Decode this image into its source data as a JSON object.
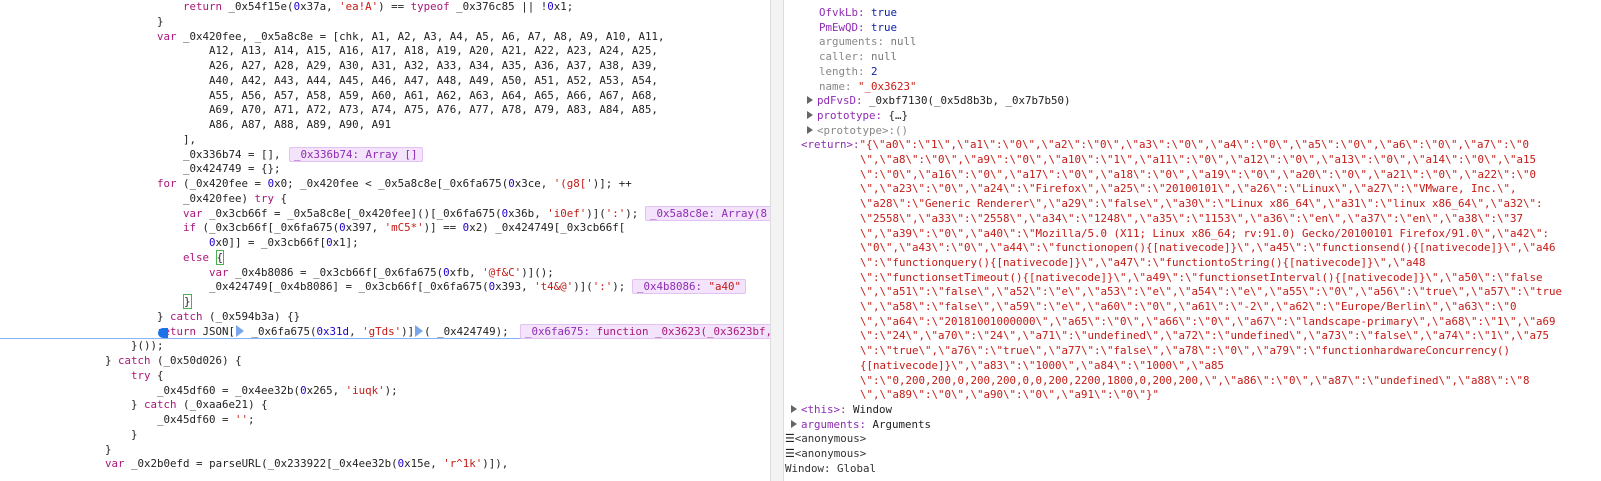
{
  "code_lines": [
    {
      "text": "        return _0x54f15e(0x37a, 'ea!A') == typeof _0x376c85 || !0x1;",
      "indent": 0
    },
    {
      "text": "    }"
    },
    {
      "text": "    var _0x420fee, _0x5a8c8e = [chk, A1, A2, A3, A4, A5, A6, A7, A8, A9, A10, A11,"
    },
    {
      "text": "        A12, A13, A14, A15, A16, A17, A18, A19, A20, A21, A22, A23, A24, A25,"
    },
    {
      "text": "        A26, A27, A28, A29, A30, A31, A32, A33, A34, A35, A36, A37, A38, A39,"
    },
    {
      "text": "        A40, A42, A43, A44, A45, A46, A47, A48, A49, A50, A51, A52, A53, A54,"
    },
    {
      "text": "        A55, A56, A57, A58, A59, A60, A61, A62, A63, A64, A65, A66, A67, A68,"
    },
    {
      "text": "        A69, A70, A71, A72, A73, A74, A75, A76, A77, A78, A79, A83, A84, A85,"
    },
    {
      "text": "        A86, A87, A88, A89, A90, A91"
    },
    {
      "text": "    ],"
    },
    {
      "text": "    _0x336b74 = [],"
    },
    {
      "text": "    _0x424749 = {};"
    },
    {
      "text": "    for (_0x420fee = 0x0; _0x420fee < _0x5a8c8e[_0x6fa675(0x3ce, '(g8[')]; ++"
    },
    {
      "text": "    _0x420fee) try {"
    },
    {
      "text": "        var _0x3cb66f = _0x5a8c8e[_0x420fee]()[_0x6fa675(0x36b, 'i0ef')](':');"
    },
    {
      "text": "        if (_0x3cb66f[_0x6fa675(0x397, 'mC5*')] == 0x2) _0x424749[_0x3cb66f["
    },
    {
      "text": "            0x0]] = _0x3cb66f[0x1];"
    },
    {
      "text": "        else {"
    },
    {
      "text": "            var _0x4b8086 = _0x3cb66f[_0x6fa675(0xfb, '@f&C')]();"
    },
    {
      "text": "            _0x424749[_0x4b8086] = _0x3cb66f[_0x6fa675(0x393, 't4&@')](':');"
    },
    {
      "text": "        }"
    },
    {
      "text": "    } catch (_0x594b3a) {}"
    },
    {
      "text": "    return JSON[ _0x6fa675(0x31d, 'gTds')]( _0x424749);"
    },
    {
      "text": "}());"
    },
    {
      "text": "} catch (_0x50d026) {"
    },
    {
      "text": "    try {"
    },
    {
      "text": "        _0x45df60 = _0x4ee32b(0x265, 'iuqk');"
    },
    {
      "text": "    } catch (_0xaa6e21) {"
    },
    {
      "text": "        _0x45df60 = '';"
    },
    {
      "text": "    }"
    },
    {
      "text": "}"
    },
    {
      "text": "var _0x2b0efd = parseURL(_0x233922[_0x4ee32b(0x15e, 'r^1k')]),"
    }
  ],
  "inline_values": {
    "v336b74": "_0x336b74: Array []",
    "v5a8c8e": "_0x5a8c8e: Array(8",
    "v4b8086_key": "_0x4b8086:",
    "v4b8086_val": "\"a40\"",
    "v6fa675_key": "_0x6fa675:",
    "v6fa675_val": "function _0x3623(_0x3623bf,"
  },
  "scope": {
    "props": [
      {
        "key": "OfvkLb:",
        "value": "true",
        "kind": "bool"
      },
      {
        "key": "PmEwQD:",
        "value": "true",
        "kind": "bool"
      },
      {
        "key": "arguments:",
        "value": "null",
        "kind": "null"
      },
      {
        "key": "caller:",
        "value": "null",
        "kind": "null"
      },
      {
        "key": "length:",
        "value": "2",
        "kind": "num"
      },
      {
        "key": "name:",
        "value": "\"_0x3623\"",
        "kind": "str"
      }
    ],
    "expandables": [
      {
        "key": "pdFvsD:",
        "value": "_0xbf7130(_0x5d8b3b, _0x7b7b50)"
      },
      {
        "key": "prototype:",
        "value": "{…}"
      },
      {
        "key": "<prototype>:",
        "value": "()"
      }
    ],
    "return_label": "<return>:",
    "return_lines": [
      "\"{\\\"a0\\\":\\\"1\\\",\\\"a1\\\":\\\"0\\\",\\\"a2\\\":\\\"0\\\",\\\"a3\\\":\\\"0\\\",\\\"a4\\\":\\\"0\\\",\\\"a5\\\":\\\"0\\\",\\\"a6\\\":\\\"0\\\",\\\"a7\\\":\\\"0",
      "\\\",\\\"a8\\\":\\\"0\\\",\\\"a9\\\":\\\"0\\\",\\\"a10\\\":\\\"1\\\",\\\"a11\\\":\\\"0\\\",\\\"a12\\\":\\\"0\\\",\\\"a13\\\":\\\"0\\\",\\\"a14\\\":\\\"0\\\",\\\"a15",
      "\\\":\\\"0\\\",\\\"a16\\\":\\\"0\\\",\\\"a17\\\":\\\"0\\\",\\\"a18\\\":\\\"0\\\",\\\"a19\\\":\\\"0\\\",\\\"a20\\\":\\\"0\\\",\\\"a21\\\":\\\"0\\\",\\\"a22\\\":\\\"0",
      "\\\",\\\"a23\\\":\\\"0\\\",\\\"a24\\\":\\\"Firefox\\\",\\\"a25\\\":\\\"20100101\\\",\\\"a26\\\":\\\"Linux\\\",\\\"a27\\\":\\\"VMware, Inc.\\\",",
      "\\\"a28\\\":\\\"Generic Renderer\\\",\\\"a29\\\":\\\"false\\\",\\\"a30\\\":\\\"Linux x86_64\\\",\\\"a31\\\":\\\"linux x86_64\\\",\\\"a32\\\":",
      "\\\"2558\\\",\\\"a33\\\":\\\"2558\\\",\\\"a34\\\":\\\"1248\\\",\\\"a35\\\":\\\"1153\\\",\\\"a36\\\":\\\"en\\\",\\\"a37\\\":\\\"en\\\",\\\"a38\\\":\\\"37",
      "\\\",\\\"a39\\\":\\\"0\\\",\\\"a40\\\":\\\"Mozilla/5.0 (X11; Linux x86_64; rv:91.0) Gecko/20100101 Firefox/91.0\\\",\\\"a42\\\":",
      "\\\"0\\\",\\\"a43\\\":\\\"0\\\",\\\"a44\\\":\\\"functionopen(){[nativecode]}\\\",\\\"a45\\\":\\\"functionsend(){[nativecode]}\\\",\\\"a46",
      "\\\":\\\"functionquery(){[nativecode]}\\\",\\\"a47\\\":\\\"functiontoString(){[nativecode]}\\\",\\\"a48",
      "\\\":\\\"functionsetTimeout(){[nativecode]}\\\",\\\"a49\\\":\\\"functionsetInterval(){[nativecode]}\\\",\\\"a50\\\":\\\"false",
      "\\\",\\\"a51\\\":\\\"false\\\",\\\"a52\\\":\\\"e\\\",\\\"a53\\\":\\\"e\\\",\\\"a54\\\":\\\"e\\\",\\\"a55\\\":\\\"0\\\",\\\"a56\\\":\\\"true\\\",\\\"a57\\\":\\\"true",
      "\\\",\\\"a58\\\":\\\"false\\\",\\\"a59\\\":\\\"e\\\",\\\"a60\\\":\\\"0\\\",\\\"a61\\\":\\\"-2\\\",\\\"a62\\\":\\\"Europe/Berlin\\\",\\\"a63\\\":\\\"0",
      "\\\",\\\"a64\\\":\\\"20181001000000\\\",\\\"a65\\\":\\\"0\\\",\\\"a66\\\":\\\"0\\\",\\\"a67\\\":\\\"landscape-primary\\\",\\\"a68\\\":\\\"1\\\",\\\"a69",
      "\\\":\\\"24\\\",\\\"a70\\\":\\\"24\\\",\\\"a71\\\":\\\"undefined\\\",\\\"a72\\\":\\\"undefined\\\",\\\"a73\\\":\\\"false\\\",\\\"a74\\\":\\\"1\\\",\\\"a75",
      "\\\":\\\"true\\\",\\\"a76\\\":\\\"true\\\",\\\"a77\\\":\\\"false\\\",\\\"a78\\\":\\\"0\\\",\\\"a79\\\":\\\"functionhardwareConcurrency()",
      "{[nativecode]}\\\",\\\"a83\\\":\\\"1000\\\",\\\"a84\\\":\\\"1000\\\",\\\"a85",
      "\\\":\\\"0,200,200,0,200,200,0,0,200,2200,1800,0,200,200,\\\",\\\"a86\\\":\\\"0\\\",\\\"a87\\\":\\\"undefined\\\",\\\"a88\\\":\\\"8",
      "\\\",\\\"a89\\\":\\\"0\\\",\\\"a90\\\":\\\"0\\\",\\\"a91\\\":\\\"0\\\"}\""
    ],
    "this_key": "<this>:",
    "this_val": "Window",
    "arguments_key": "arguments:",
    "arguments_val": "Arguments",
    "anon1": "<anonymous>",
    "anon2": "<anonymous>",
    "window_key": "Window:",
    "window_val": "Global"
  }
}
